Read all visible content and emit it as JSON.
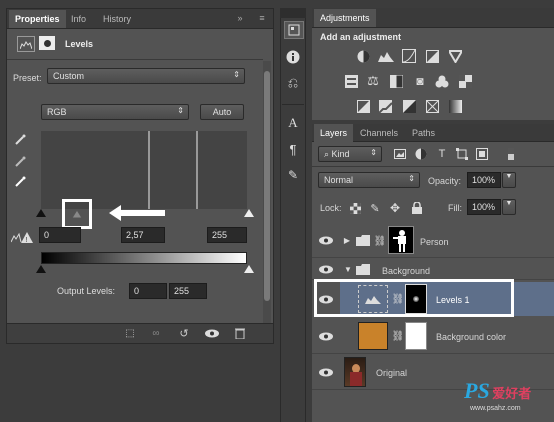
{
  "properties_panel": {
    "tabs": [
      "Properties",
      "Info",
      "History"
    ],
    "panel_title": "Levels",
    "preset_label": "Preset:",
    "preset_value": "Custom",
    "channel_value": "RGB",
    "auto_label": "Auto",
    "input_black": "0",
    "input_mid": "2,57",
    "input_white": "255",
    "output_label": "Output Levels:",
    "output_black": "0",
    "output_white": "255"
  },
  "adjustments_panel": {
    "tab": "Adjustments",
    "heading": "Add an adjustment"
  },
  "layers_panel": {
    "tabs": [
      "Layers",
      "Channels",
      "Paths"
    ],
    "kind_label": "Kind",
    "blend_mode": "Normal",
    "opacity_label": "Opacity:",
    "opacity_value": "100%",
    "lock_label": "Lock:",
    "fill_label": "Fill:",
    "fill_value": "100%",
    "layers": [
      {
        "name": "Person"
      },
      {
        "name": "Background"
      },
      {
        "name": "Levels 1"
      },
      {
        "name": "Background color"
      },
      {
        "name": "Original"
      }
    ]
  },
  "watermark": {
    "brand": "PS",
    "chinese": "爱好者",
    "url": "www.psahz.com"
  },
  "colors": {
    "panel": "#535353",
    "dark": "#3c3c3c",
    "highlight_box": "#ffffff",
    "selected_layer": "#5e6f8a",
    "swatch": "#c9822a"
  }
}
